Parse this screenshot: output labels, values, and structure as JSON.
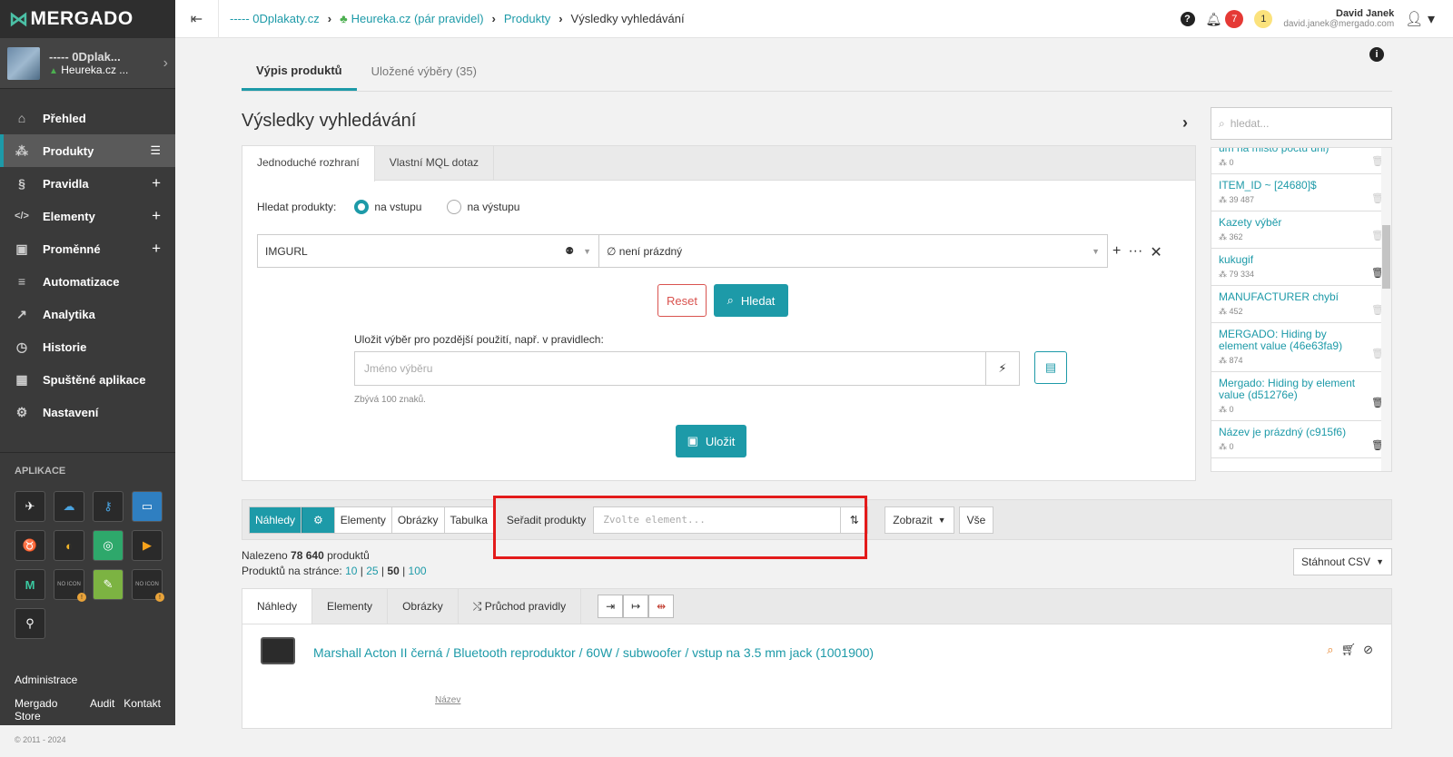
{
  "brand": {
    "logo": "MERGADO"
  },
  "shop": {
    "name": "----- 0Dplak...",
    "feed": "Heureka.cz ..."
  },
  "nav": [
    {
      "label": "Přehled",
      "icon": "home-icon"
    },
    {
      "label": "Produkty",
      "icon": "products-icon"
    },
    {
      "label": "Pravidla",
      "icon": "section-icon"
    },
    {
      "label": "Elementy",
      "icon": "code-icon"
    },
    {
      "label": "Proměnné",
      "icon": "variables-icon"
    },
    {
      "label": "Automatizace",
      "icon": "automation-icon"
    },
    {
      "label": "Analytika",
      "icon": "chart-icon"
    },
    {
      "label": "Historie",
      "icon": "history-icon"
    },
    {
      "label": "Spuštěné aplikace",
      "icon": "apps-icon"
    },
    {
      "label": "Nastavení",
      "icon": "gear-icon"
    }
  ],
  "apps_title": "APLIKACE",
  "sidebar_links": {
    "admin": "Administrace",
    "store": "Mergado Store",
    "audit": "Audit",
    "contact": "Kontakt",
    "copyright": "© 2011 - 2024"
  },
  "breadcrumb": [
    "----- 0Dplakaty.cz",
    "Heureka.cz (pár pravidel)",
    "Produkty",
    "Výsledky vyhledávání"
  ],
  "notifications": {
    "count_red": "7",
    "count_yellow": "1"
  },
  "user": {
    "name": "David Janek",
    "email": "david.janek@mergado.com"
  },
  "tabs": [
    "Výpis produktů",
    "Uložené výběry (35)"
  ],
  "page_title": "Výsledky vyhledávání",
  "query": {
    "tabs": [
      "Jednoduché rozhraní",
      "Vlastní MQL dotaz"
    ],
    "search_label": "Hledat produkty:",
    "radio_in": "na vstupu",
    "radio_out": "na výstupu",
    "element": "IMGURL",
    "condition": "∅ není prázdný",
    "reset": "Reset",
    "search": "Hledat",
    "save_label": "Uložit výběr pro pozdější použití, např. v pravidlech:",
    "save_placeholder": "Jméno výběru",
    "remaining": "Zbývá 100 znaků.",
    "save": "Uložit"
  },
  "saved": {
    "search_placeholder": "hledat...",
    "items": [
      {
        "name": "um na misto poctu dni)",
        "count": "0",
        "deletable": false
      },
      {
        "name": "ITEM_ID ~ [24680]$",
        "count": "39 487",
        "deletable": false
      },
      {
        "name": "Kazety výběr",
        "count": "362",
        "deletable": false
      },
      {
        "name": "kukugif",
        "count": "79 334",
        "deletable": true
      },
      {
        "name": "MANUFACTURER chybí",
        "count": "452",
        "deletable": false
      },
      {
        "name": "MERGADO: Hiding by element value (46e63fa9)",
        "count": "874",
        "deletable": false
      },
      {
        "name": "Mergado: Hiding by element value (d51276e)",
        "count": "0",
        "deletable": true
      },
      {
        "name": "Název je prázdný (c915f6)",
        "count": "0",
        "deletable": true
      }
    ]
  },
  "toolbar": {
    "views": [
      "Náhledy",
      "⚙",
      "Elementy",
      "Obrázky",
      "Tabulka"
    ],
    "sort_label": "Seřadit produkty",
    "sort_placeholder": "Zvolte element...",
    "show": "Zobrazit",
    "all": "Vše"
  },
  "results": {
    "found_prefix": "Nalezeno",
    "found_count": "78 640",
    "found_suffix": "produktů",
    "per_page_label": "Produktů na stránce:",
    "per_page": [
      "10",
      "25",
      "50",
      "100"
    ],
    "csv": "Stáhnout CSV"
  },
  "result_tabs": [
    "Náhledy",
    "Elementy",
    "Obrázky",
    "Průchod pravidly"
  ],
  "product": {
    "title": "Marshall Acton II černá / Bluetooth reproduktor / 60W / subwoofer / vstup na 3.5 mm jack (1001900)",
    "field_label": "Název"
  },
  "colors": {
    "accent": "#1d9aa8",
    "danger": "#d9534f",
    "highlight": "#e31b1b"
  }
}
